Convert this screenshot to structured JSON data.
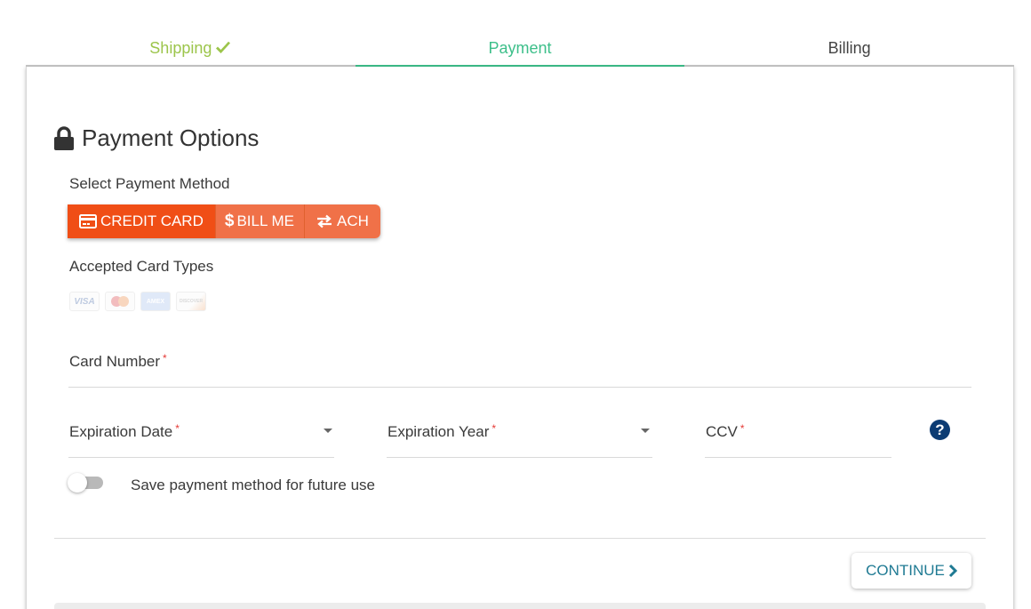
{
  "tabs": [
    {
      "label": "Shipping",
      "state": "completed",
      "icon": "check-icon"
    },
    {
      "label": "Payment",
      "state": "active"
    },
    {
      "label": "Billing",
      "state": "pending"
    }
  ],
  "heading": {
    "icon": "lock-icon",
    "title": "Payment Options"
  },
  "payment_method": {
    "label": "Select Payment Method",
    "options": [
      {
        "label": "CREDIT CARD",
        "icon": "credit-card-icon",
        "selected": true
      },
      {
        "label": "BILL ME",
        "icon": "dollar-icon",
        "selected": false
      },
      {
        "label": "ACH",
        "icon": "exchange-icon",
        "selected": false
      }
    ]
  },
  "accepted_cards": {
    "label": "Accepted Card Types",
    "types": [
      "VISA",
      "MasterCard",
      "AMEX",
      "DISCOVER"
    ]
  },
  "fields": {
    "card_number": {
      "label": "Card Number",
      "required": "*",
      "value": ""
    },
    "expiration_date": {
      "label": "Expiration Date",
      "required": "*",
      "value": ""
    },
    "expiration_year": {
      "label": "Expiration Year",
      "required": "*",
      "value": ""
    },
    "ccv": {
      "label": "CCV",
      "required": "*",
      "value": "",
      "help_icon": "?"
    }
  },
  "save_toggle": {
    "label": "Save payment method for future use",
    "checked": false
  },
  "continue_button": {
    "label": "CONTINUE"
  },
  "colors": {
    "completed": "#9cc54b",
    "active": "#3dbf8a",
    "accent": "#f04e16",
    "accent_light": "#f07148",
    "help": "#0d3c73",
    "continue_text": "#1f7a93",
    "required": "#e53935"
  }
}
